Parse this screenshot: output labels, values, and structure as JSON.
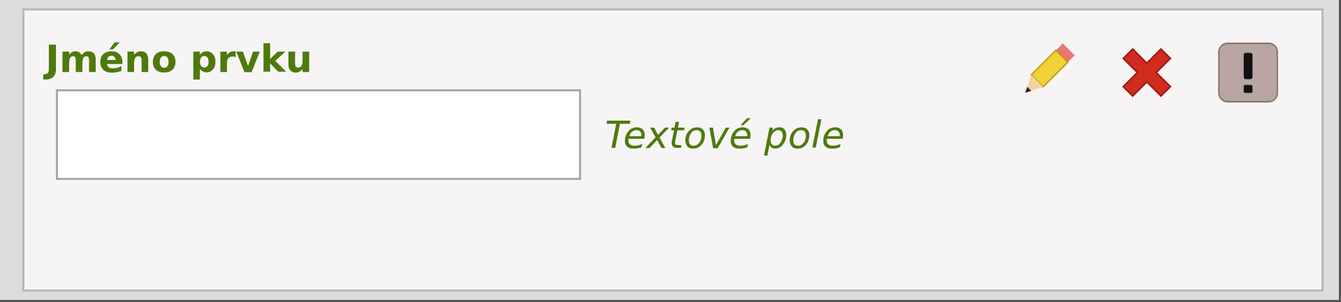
{
  "element": {
    "title": "Jméno prvku",
    "type_label": "Textové pole"
  }
}
